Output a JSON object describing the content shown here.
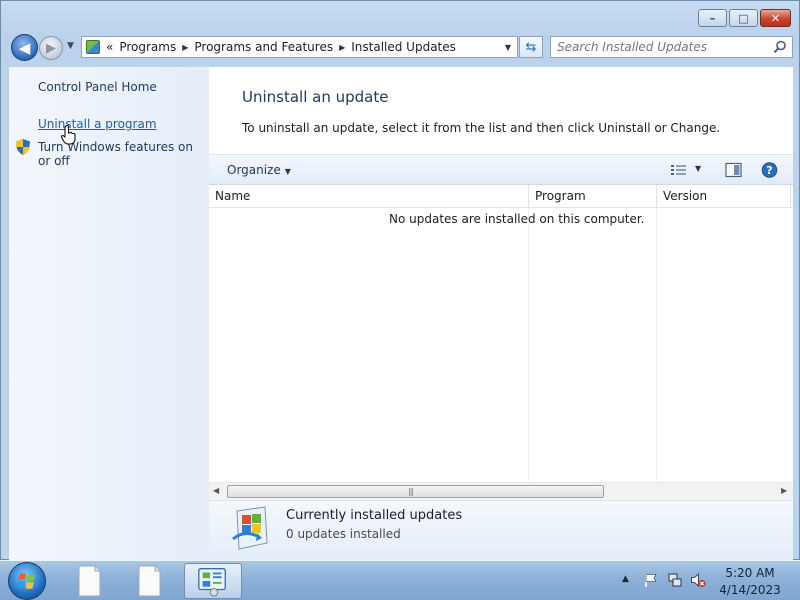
{
  "window": {
    "caption_buttons": {
      "minimize": "–",
      "maximize": "□",
      "close": "✕"
    }
  },
  "navigation": {
    "breadcrumbs": [
      "«",
      "Programs",
      "Programs and Features",
      "Installed Updates"
    ],
    "search_placeholder": "Search Installed Updates"
  },
  "left_pane": {
    "links": [
      {
        "label": "Control Panel Home"
      },
      {
        "label": "Uninstall a program"
      },
      {
        "label": "Turn Windows features on or off"
      }
    ]
  },
  "main": {
    "title": "Uninstall an update",
    "description": "To uninstall an update, select it from the list and then click Uninstall or Change.",
    "toolbar": {
      "organize_label": "Organize"
    },
    "columns": [
      "Name",
      "Program",
      "Version"
    ],
    "empty_message": "No updates are installed on this computer.",
    "details": {
      "title": "Currently installed updates",
      "subtitle": "0 updates installed"
    }
  },
  "taskbar": {
    "time": "5:20 AM",
    "date": "4/14/2023"
  },
  "icons": {
    "back": "arrow-left-icon",
    "forward": "arrow-right-icon",
    "refresh": "refresh-icon",
    "search": "search-icon",
    "shield": "uac-shield-icon",
    "help": "help-icon",
    "start": "windows-start-icon",
    "flag": "action-center-flag-icon",
    "network": "network-icon",
    "sound": "sound-muted-icon"
  },
  "colors": {
    "link": "#1e5fa8",
    "title": "#1e395b",
    "close_button": "#c8452f"
  }
}
